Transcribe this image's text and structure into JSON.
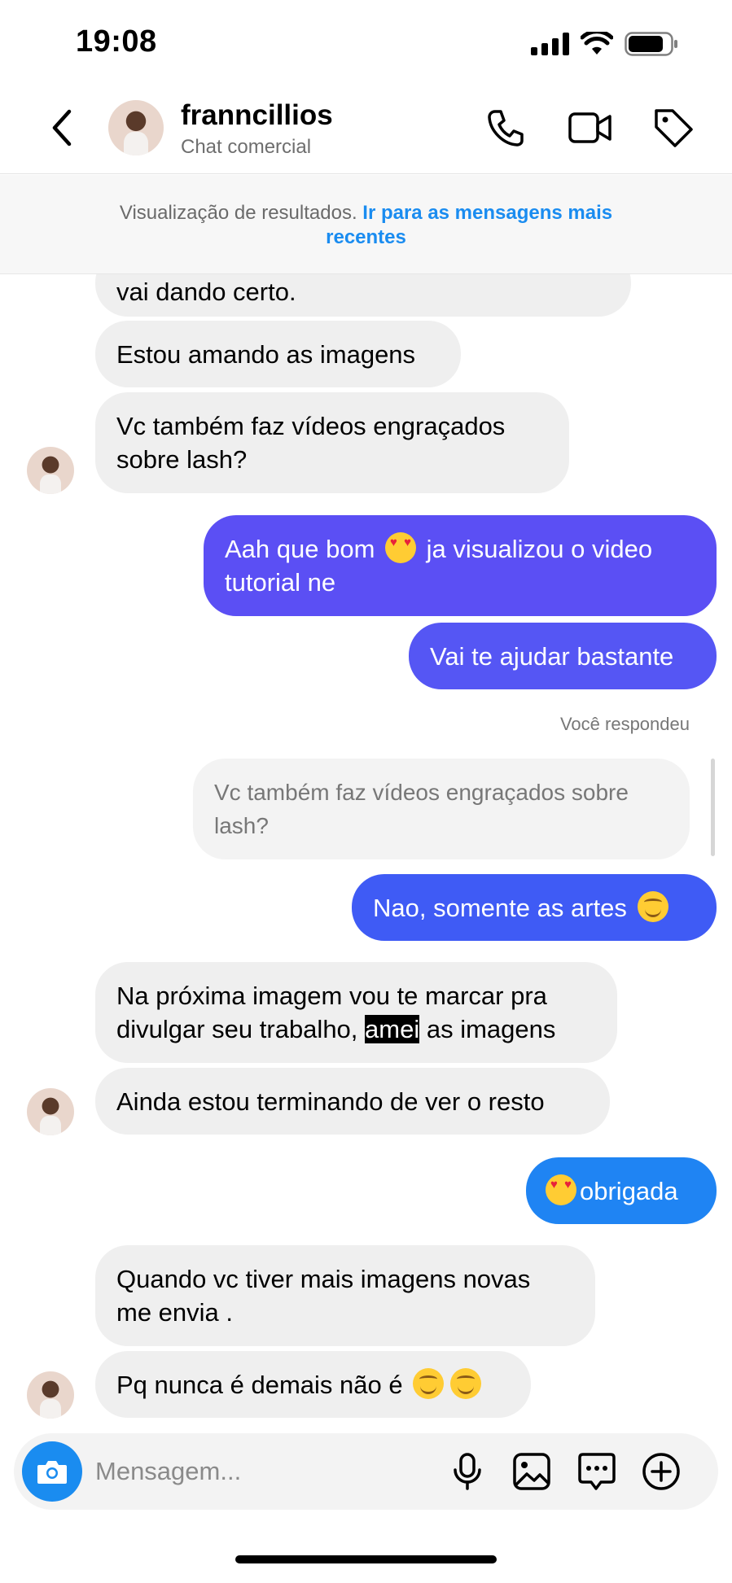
{
  "status": {
    "time": "19:08"
  },
  "header": {
    "name": "franncillios",
    "subtitle": "Chat comercial"
  },
  "banner": {
    "text": "Visualização de resultados. ",
    "link": "Ir para as mensagens mais recentes"
  },
  "messages": {
    "m1": "vai dando certo.",
    "m2": "Estou amando as imagens",
    "m3": "Vc também faz vídeos engraçados sobre lash?",
    "m4_a": "Aah que bom ",
    "m4_b": " ja visualizou o video tutorial ne",
    "m5": "Vai te ajudar bastante",
    "replied_label": "Você respondeu",
    "reply_quote": "Vc também faz vídeos engraçados sobre lash?",
    "m6": "Nao, somente as artes ",
    "m7_a": "Na próxima imagem vou te marcar pra divulgar seu trabalho, ",
    "m7_hl": "amei",
    "m7_b": " as imagens",
    "m8": "Ainda estou terminando de ver o resto",
    "m9": "obrigada",
    "m10": "Quando vc tiver mais imagens novas me envia .",
    "m11": "Pq nunca é demais não é "
  },
  "composer": {
    "placeholder": "Mensagem..."
  },
  "colors": {
    "outgoing_purple": "#5b4ff4",
    "outgoing_blue": "#3f5bf5",
    "outgoing_light_blue": "#1f84f3",
    "link_blue": "#1a8cf0",
    "incoming_bg": "#efefef"
  },
  "icons": [
    "back-arrow-icon",
    "phone-icon",
    "video-call-icon",
    "tag-icon",
    "camera-icon",
    "microphone-icon",
    "gallery-icon",
    "sticker-icon",
    "plus-icon"
  ]
}
